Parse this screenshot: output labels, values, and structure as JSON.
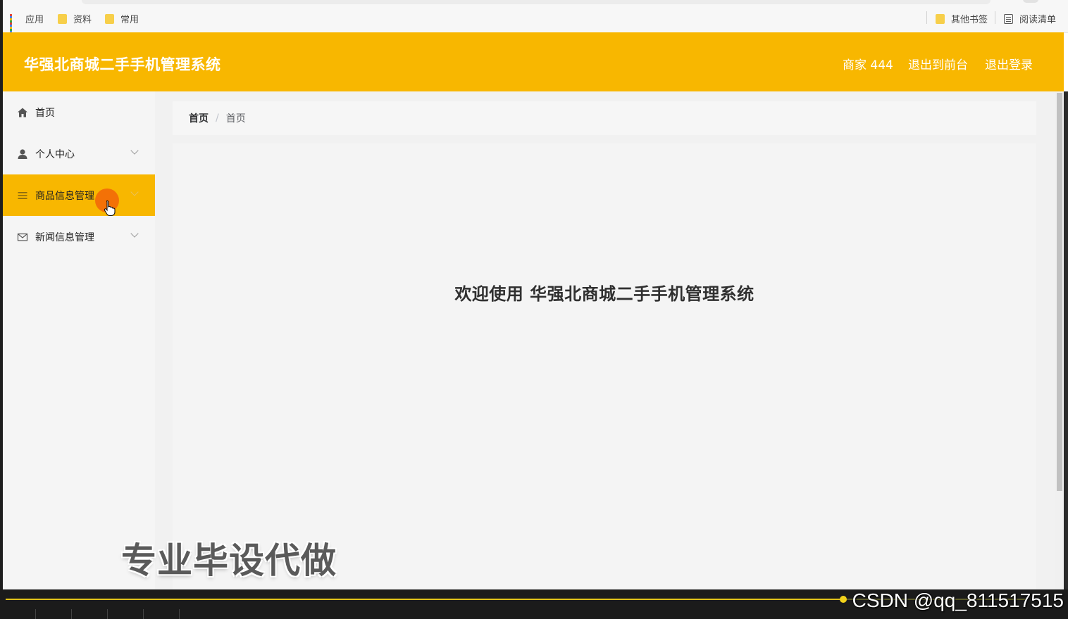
{
  "browser": {
    "bookmarks_left": [
      {
        "label": "应用",
        "icon": "apps-grid-icon"
      },
      {
        "label": "资料",
        "icon": "folder-icon"
      },
      {
        "label": "常用",
        "icon": "folder-icon"
      }
    ],
    "bookmarks_right": [
      {
        "label": "其他书签",
        "icon": "folder-icon"
      },
      {
        "label": "阅读清单",
        "icon": "reading-list-icon"
      }
    ]
  },
  "header": {
    "title": "华强北商城二手手机管理系统",
    "user": "商家 444",
    "front_link": "退出到前台",
    "logout_link": "退出登录",
    "color": "#f8b700"
  },
  "sidebar": {
    "items": [
      {
        "label": "首页",
        "icon": "home-icon",
        "has_submenu": false,
        "active": false
      },
      {
        "label": "个人中心",
        "icon": "user-icon",
        "has_submenu": true,
        "active": false
      },
      {
        "label": "商品信息管理",
        "icon": "menu-list-icon",
        "has_submenu": true,
        "active": true
      },
      {
        "label": "新闻信息管理",
        "icon": "mail-icon",
        "has_submenu": true,
        "active": false
      }
    ]
  },
  "breadcrumb": [
    "首页",
    "首页"
  ],
  "main": {
    "welcome": "欢迎使用 华强北商城二手手机管理系统"
  },
  "overlay": {
    "watermark": "专业毕设代做",
    "credit": "CSDN @qq_811517515"
  },
  "player": {
    "progress": 0.82
  }
}
